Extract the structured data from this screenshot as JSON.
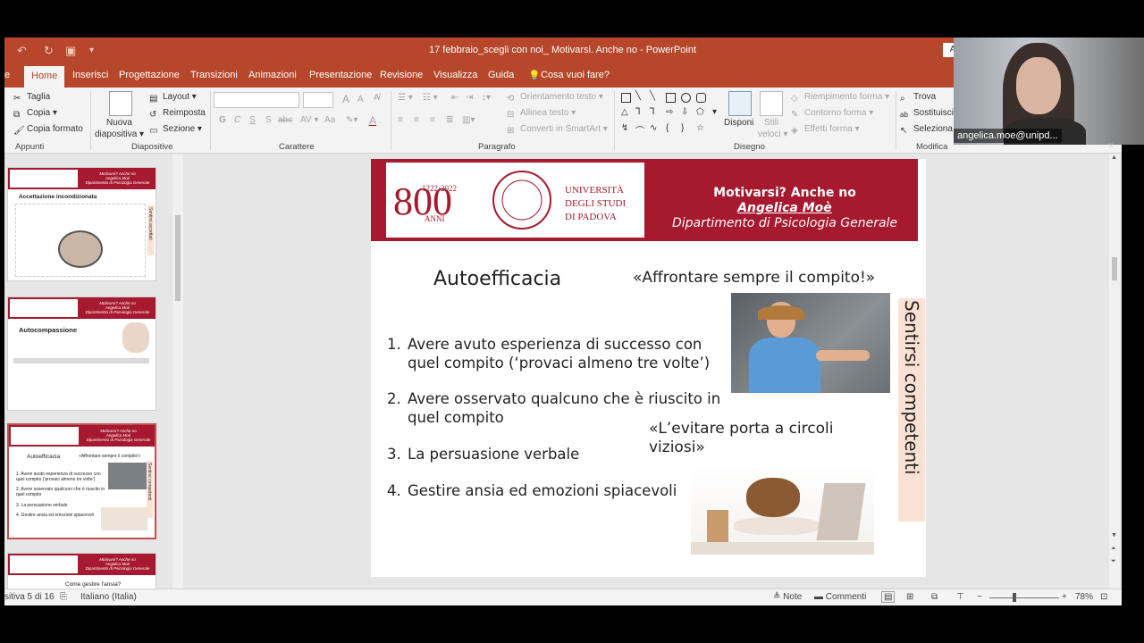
{
  "window": {
    "title": "17 febbraio_scegli con noi_ Motivarsi. Anche no  -  PowerPoint",
    "account_initial": "A"
  },
  "tabs": [
    "Home",
    "Inserisci",
    "Progettazione",
    "Transizioni",
    "Animazioni",
    "Presentazione",
    "Revisione",
    "Visualizza",
    "Guida",
    "Cosa vuoi fare?"
  ],
  "ribbon": {
    "clipboard": {
      "cut": "Taglia",
      "copy": "Copia",
      "format_painter": "Copia formato",
      "label": "Appunti"
    },
    "slides": {
      "new_slide": "Nuova",
      "new_slide2": "diapositiva",
      "layout": "Layout",
      "reset": "Reimposta",
      "section": "Sezione",
      "label": "Diapositive"
    },
    "font": {
      "bold": "G",
      "italic": "C",
      "underline": "S",
      "strike": "S",
      "spacing": "abc",
      "case": "Aa",
      "color": "A",
      "label": "Carattere",
      "grow": "A",
      "shrink": "A"
    },
    "paragraph": {
      "text_direction": "Orientamento testo",
      "align_text": "Allinea testo",
      "smartart": "Converti in SmartArt",
      "label": "Paragrafo"
    },
    "drawing": {
      "arrange": "Disponi",
      "quick_styles": "Stili",
      "quick_styles2": "veloci",
      "fill": "Riempimento forma",
      "outline": "Contorno forma",
      "effects": "Effetti forma",
      "label": "Disegno"
    },
    "editing": {
      "find": "Trova",
      "replace": "Sostituisci",
      "select": "Seleziona",
      "label": "Modifica"
    }
  },
  "thumbnails": [
    {
      "header": "Motivarsi? Anche no\nAngelica Moè\nDipartimento di Psicologia Generale",
      "title": "Accettazione incondizionata",
      "side": "Sentirsi accettati"
    },
    {
      "header": "Motivarsi? Anche no\nAngelica Moè\nDipartimento di Psicologia Generale",
      "title": "Autocompassione",
      "side": ""
    },
    {
      "header": "Motivarsi? Anche no\nAngelica Moè\nDipartimento di Psicologia Generale",
      "title": "Autoefficacia",
      "quote": "«Affrontare sempre il compito!»",
      "side": "Sentirsi competenti",
      "items": [
        "1. Avere avuto esperienza di successo con quel compito (‘provaci almeno tre volte’)",
        "2. Avere osservato qualcuno che è riuscito in quel compito",
        "3. La persuasione verbale",
        "4. Gestire ansia ed emozioni spiacevoli"
      ]
    },
    {
      "header": "Motivarsi? Anche no\nAngelica Moè\nDipartimento di Psicologia Generale",
      "title": "Come gestire l'ansia?",
      "side": ""
    }
  ],
  "slide": {
    "banner": {
      "line1": "Motivarsi? Anche no",
      "line2": "Angelica Moè",
      "line3": "Dipartimento di Psicologia Generale"
    },
    "logo": {
      "years": "1222·2022",
      "anni": "ANNI",
      "big": "800",
      "univ1": "UNIVERSITÀ",
      "univ2": "DEGLI STUDI",
      "univ3": "DI PADOVA"
    },
    "heading": "Autoefficacia",
    "quote1": "«Affrontare sempre il compito!»",
    "quote2_l1": "«L’evitare porta a circoli",
    "quote2_l2": "viziosi»",
    "items": [
      {
        "n": "1.",
        "l1": "Avere avuto esperienza di successo con",
        "l2": "quel compito (‘provaci almeno tre volte’)"
      },
      {
        "n": "2.",
        "l1": "Avere osservato qualcuno che è riuscito in",
        "l2": "quel compito"
      },
      {
        "n": "3.",
        "l1": "La persuasione verbale",
        "l2": ""
      },
      {
        "n": "4.",
        "l1": "Gestire ansia ed emozioni spiacevoli",
        "l2": ""
      }
    ],
    "side_label": "Sentirsi competenti"
  },
  "status": {
    "slide_count": "sitiva 5 di 16",
    "language": "Italiano (Italia)",
    "notes": "Note",
    "comments": "Commenti",
    "zoom": "78%"
  },
  "webcam": {
    "name": "angelica.moe@unipd..."
  },
  "colors": {
    "ppt_red": "#b7472a",
    "unipd_red": "#a6192e",
    "side_peach": "#fbe1d3"
  }
}
